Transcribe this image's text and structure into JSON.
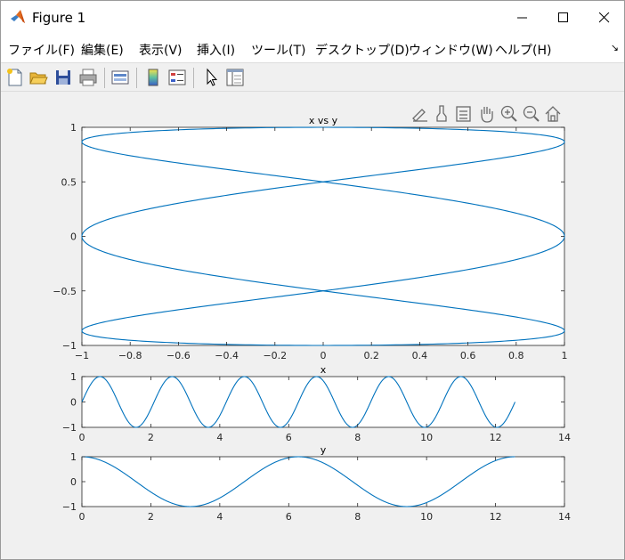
{
  "window": {
    "title": "Figure 1",
    "icon": "matlab-logo-icon",
    "controls": [
      "minimize-icon",
      "maximize-icon",
      "close-icon"
    ]
  },
  "menu": [
    {
      "label": "ファイル(F)"
    },
    {
      "label": "編集(E)"
    },
    {
      "label": "表示(V)"
    },
    {
      "label": "挿入(I)"
    },
    {
      "label": "ツール(T)"
    },
    {
      "label": "デスクトップ(D)"
    },
    {
      "label": "ウィンドウ(W)"
    },
    {
      "label": "ヘルプ(H)"
    }
  ],
  "toolbar": [
    "new-figure-icon",
    "open-file-icon",
    "save-icon",
    "print-icon",
    "link-plot-icon",
    "colorbar-icon",
    "legend-icon",
    "select-pointer-icon",
    "property-inspector-icon"
  ],
  "axes_toolbar": [
    "brush-edit-icon",
    "data-brush-icon",
    "data-tips-icon",
    "pan-hand-icon",
    "zoom-in-icon",
    "zoom-out-icon",
    "home-icon"
  ],
  "colors": {
    "line": "#0072BD",
    "axes_bg": "#ffffff",
    "figure_bg": "#f0f0f0",
    "axis_line": "#262626"
  },
  "chart_data": [
    {
      "type": "line",
      "title": "x vs y",
      "xlabel": "",
      "ylabel": "",
      "xlim": [
        -1,
        1
      ],
      "ylim": [
        -1,
        1
      ],
      "xticks": [
        "−1",
        "−0.8",
        "−0.6",
        "−0.4",
        "−0.2",
        "0",
        "0.2",
        "0.4",
        "0.6",
        "0.8",
        "1"
      ],
      "yticks": [
        "−1",
        "−0.5",
        "0",
        "0.5",
        "1"
      ],
      "grid": false,
      "series": [
        {
          "x_expr": "sin(3t)",
          "y_expr": "cos(t)",
          "t_range": [
            0,
            12.566
          ]
        }
      ]
    },
    {
      "type": "line",
      "title": "x",
      "xlim": [
        0,
        14
      ],
      "ylim": [
        -1,
        1
      ],
      "xticks": [
        "0",
        "2",
        "4",
        "6",
        "8",
        "10",
        "12",
        "14"
      ],
      "yticks": [
        "−1",
        "0",
        "1"
      ],
      "grid": false,
      "series": [
        {
          "x_expr": "t",
          "y_expr": "sin(3t)",
          "t_range": [
            0,
            12.566
          ]
        }
      ]
    },
    {
      "type": "line",
      "title": "y",
      "xlim": [
        0,
        14
      ],
      "ylim": [
        -1,
        1
      ],
      "xticks": [
        "0",
        "2",
        "4",
        "6",
        "8",
        "10",
        "12",
        "14"
      ],
      "yticks": [
        "−1",
        "0",
        "1"
      ],
      "grid": false,
      "series": [
        {
          "x_expr": "t",
          "y_expr": "cos(t)",
          "t_range": [
            0,
            12.566
          ]
        }
      ]
    }
  ]
}
